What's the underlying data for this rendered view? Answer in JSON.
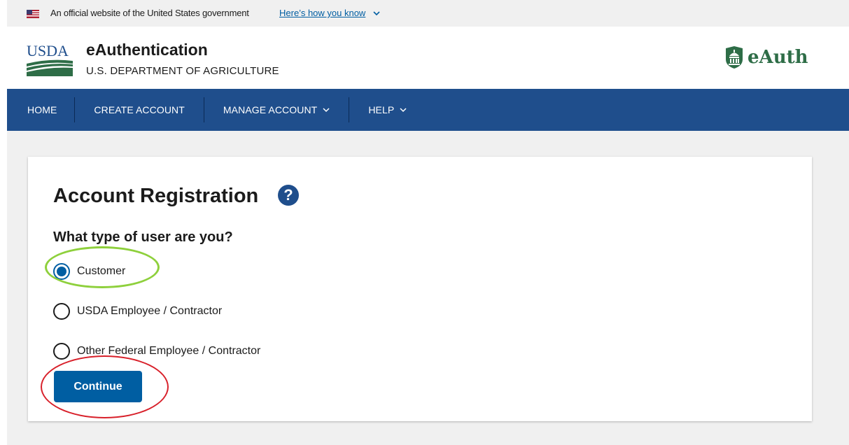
{
  "gov_banner": {
    "text": "An official website of the United States government",
    "link": "Here’s how you know"
  },
  "header": {
    "usda_logo_text": "USDA",
    "title": "eAuthentication",
    "subtitle": "U.S. DEPARTMENT OF AGRICULTURE",
    "brand_logo_text": "eAuth"
  },
  "nav": {
    "items": [
      {
        "label": "HOME"
      },
      {
        "label": "CREATE ACCOUNT"
      },
      {
        "label": "MANAGE ACCOUNT"
      },
      {
        "label": "HELP"
      }
    ]
  },
  "form": {
    "title": "Account Registration",
    "help_icon_glyph": "?",
    "question": "What type of user are you?",
    "options": [
      {
        "label": "Customer",
        "selected": true
      },
      {
        "label": "USDA Employee / Contractor",
        "selected": false
      },
      {
        "label": "Other Federal Employee / Contractor",
        "selected": false
      }
    ],
    "continue_label": "Continue"
  },
  "colors": {
    "nav_bg": "#1f4e8c",
    "primary": "#005ea2",
    "highlight_green": "#8ed03c",
    "highlight_red": "#d8202a",
    "brand_green": "#2e6d47"
  },
  "icons": [
    "us-flag-icon",
    "chevron-down-icon",
    "help-icon",
    "capitol-icon"
  ]
}
